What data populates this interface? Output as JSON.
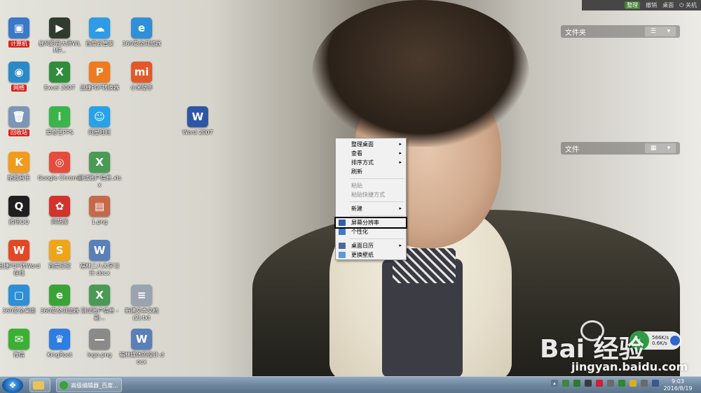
{
  "top_bar": {
    "organize": "整理",
    "undo": "撤销",
    "desktop": "桌面",
    "shutdown": "关机"
  },
  "fences": [
    {
      "title": "文件夹",
      "ctl_list": "☰",
      "ctl_down": "▾"
    },
    {
      "title": "文件",
      "ctl_list": "▦",
      "ctl_down": "▾"
    }
  ],
  "icons": [
    {
      "label": "计算机",
      "glyph": "▣",
      "color": "#3a78c8",
      "icon": "computer-icon"
    },
    {
      "label": "暴风影音大师WLMP...",
      "glyph": "▶",
      "color": "#2f3b2f",
      "icon": "video-player-icon"
    },
    {
      "label": "百度云管家",
      "glyph": "☁",
      "color": "#2d9be6",
      "icon": "cloud-icon"
    },
    {
      "label": "360安全浏览器",
      "glyph": "e",
      "color": "#2f8fd8",
      "icon": "ie-browser-icon"
    },
    {
      "label": "网络",
      "glyph": "◉",
      "color": "#2a8ac8",
      "icon": "network-icon"
    },
    {
      "label": "Excel 2007",
      "glyph": "X",
      "color": "#2f8d3c",
      "icon": "excel-icon"
    },
    {
      "label": "迅捷PDF转换器",
      "glyph": "P",
      "color": "#ef7b1f",
      "icon": "pdf-converter-icon"
    },
    {
      "label": "小米助手",
      "glyph": "mi",
      "color": "#e3582a",
      "icon": "mi-assistant-icon"
    },
    {
      "label": "回收站",
      "glyph": "🗑",
      "color": "#7b96b8",
      "icon": "recycle-bin-icon"
    },
    {
      "label": "爱奇艺PPS",
      "glyph": "i",
      "color": "#39b54a",
      "icon": "iqiyi-icon"
    },
    {
      "label": "阿里旺旺",
      "glyph": "☺",
      "color": "#27a2e8",
      "icon": "aliwangwang-icon"
    },
    {
      "label": "Word 2007",
      "glyph": "W",
      "color": "#2b57a6",
      "icon": "word-icon"
    },
    {
      "label": "酷我音乐",
      "glyph": "K",
      "color": "#f29a1c",
      "icon": "kuwo-music-icon"
    },
    {
      "label": "Google Chrome",
      "glyph": "◎",
      "color": "#e64c3c",
      "icon": "chrome-icon"
    },
    {
      "label": "测试账户信息.xlsx",
      "glyph": "X",
      "color": "#4a9a55",
      "icon": "excel-file-icon"
    },
    {
      "label": "腾讯QQ",
      "glyph": "Q",
      "color": "#1f1f1f",
      "icon": "qq-icon"
    },
    {
      "label": "同花顺",
      "glyph": "✿",
      "color": "#d3332b",
      "icon": "tonghuashun-icon"
    },
    {
      "label": "1.png",
      "glyph": "▤",
      "color": "#c46a4a",
      "icon": "image-file-icon"
    },
    {
      "label": "迅捷PDF转Word在线",
      "glyph": "W",
      "color": "#e34826",
      "icon": "pdf-word-icon"
    },
    {
      "label": "百度宝宝",
      "glyph": "S",
      "color": "#f0a418",
      "icon": "baidu-app-icon"
    },
    {
      "label": "福林二八大学习计.docx",
      "glyph": "W",
      "color": "#5b7fb8",
      "icon": "word-file-icon"
    },
    {
      "label": "360安全桌面",
      "glyph": "▢",
      "color": "#2d8fd6",
      "icon": "360-desktop-icon"
    },
    {
      "label": "360安全浏览器",
      "glyph": "e",
      "color": "#3aa335",
      "icon": "360-browser-icon"
    },
    {
      "label": "测试账户信息 - 副...",
      "glyph": "X",
      "color": "#4a9a55",
      "icon": "excel-file-copy-icon"
    },
    {
      "label": "新建文本文档 (2).txt",
      "glyph": "≡",
      "color": "#9aa4b0",
      "icon": "text-file-icon"
    },
    {
      "label": "微信",
      "glyph": "✉",
      "color": "#3cb034",
      "icon": "wechat-icon"
    },
    {
      "label": "KingRoot",
      "glyph": "♛",
      "color": "#2d7de2",
      "icon": "kingroot-icon"
    },
    {
      "label": "logo.png",
      "glyph": "—",
      "color": "#8a8a8a",
      "icon": "logo-image-icon"
    },
    {
      "label": "福林媒体的设计.docx",
      "glyph": "W",
      "color": "#5b7fb8",
      "icon": "word-doc-icon"
    }
  ],
  "context_menu": {
    "items": [
      {
        "label": "整理桌面",
        "arrow": "▸",
        "disabled": false
      },
      {
        "label": "查看",
        "arrow": "▸",
        "disabled": false
      },
      {
        "label": "排序方式",
        "arrow": "▸",
        "disabled": false
      },
      {
        "label": "刷新",
        "arrow": "",
        "disabled": false
      },
      {
        "label": "粘贴",
        "arrow": "",
        "disabled": true
      },
      {
        "label": "粘贴快捷方式",
        "arrow": "",
        "disabled": true
      },
      {
        "label": "新建",
        "arrow": "▸",
        "disabled": false
      },
      {
        "label": "屏幕分辨率",
        "arrow": "",
        "disabled": false
      },
      {
        "label": "个性化",
        "arrow": "",
        "disabled": false
      },
      {
        "label": "桌面日历",
        "arrow": "▸",
        "disabled": false
      },
      {
        "label": "更换壁纸",
        "arrow": "",
        "disabled": false
      }
    ]
  },
  "taskbar": {
    "start_glyph": "❖",
    "task_editor": "高级编辑器_百度...",
    "clock_time": "9:03",
    "clock_date": "2016/8/19"
  },
  "net_widget": {
    "up": "566K/s",
    "down": "0.6K/s"
  },
  "watermark": {
    "text": "Bai 经验",
    "url": "jingyan.baidu.com"
  }
}
